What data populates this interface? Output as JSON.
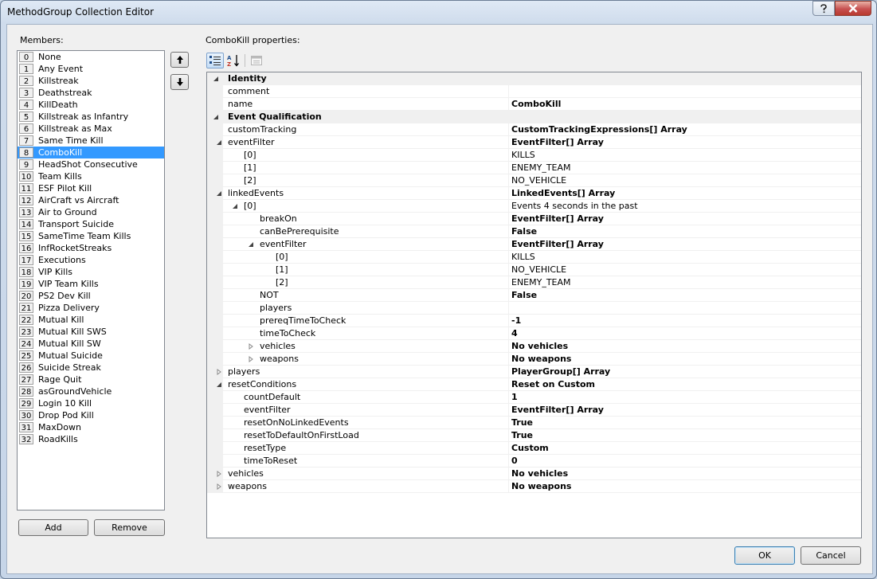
{
  "window": {
    "title": "MethodGroup Collection Editor"
  },
  "members_label": "Members:",
  "properties_label": "ComboKill properties:",
  "members": [
    {
      "index": "0",
      "name": "None"
    },
    {
      "index": "1",
      "name": "Any Event"
    },
    {
      "index": "2",
      "name": "Killstreak"
    },
    {
      "index": "3",
      "name": "Deathstreak"
    },
    {
      "index": "4",
      "name": "KillDeath"
    },
    {
      "index": "5",
      "name": "Killstreak as Infantry"
    },
    {
      "index": "6",
      "name": "Killstreak as Max"
    },
    {
      "index": "7",
      "name": "Same Time Kill"
    },
    {
      "index": "8",
      "name": "ComboKill"
    },
    {
      "index": "9",
      "name": "HeadShot Consecutive"
    },
    {
      "index": "10",
      "name": "Team Kills"
    },
    {
      "index": "11",
      "name": "ESF Pilot Kill"
    },
    {
      "index": "12",
      "name": "AirCraft vs Aircraft"
    },
    {
      "index": "13",
      "name": "Air to Ground"
    },
    {
      "index": "14",
      "name": "Transport Suicide"
    },
    {
      "index": "15",
      "name": "SameTime Team Kills"
    },
    {
      "index": "16",
      "name": "InfRocketStreaks"
    },
    {
      "index": "17",
      "name": "Executions"
    },
    {
      "index": "18",
      "name": "VIP Kills"
    },
    {
      "index": "19",
      "name": "VIP Team Kills"
    },
    {
      "index": "20",
      "name": "PS2 Dev Kill"
    },
    {
      "index": "21",
      "name": "Pizza Delivery"
    },
    {
      "index": "22",
      "name": "Mutual Kill"
    },
    {
      "index": "23",
      "name": "Mutual Kill SWS"
    },
    {
      "index": "24",
      "name": "Mutual Kill SW"
    },
    {
      "index": "25",
      "name": "Mutual Suicide"
    },
    {
      "index": "26",
      "name": "Suicide Streak"
    },
    {
      "index": "27",
      "name": "Rage Quit"
    },
    {
      "index": "28",
      "name": "asGroundVehicle"
    },
    {
      "index": "29",
      "name": "Login 10 Kill"
    },
    {
      "index": "30",
      "name": "Drop Pod Kill"
    },
    {
      "index": "31",
      "name": "MaxDown"
    },
    {
      "index": "32",
      "name": "RoadKills"
    }
  ],
  "selected_member_index": 8,
  "buttons": {
    "add": "Add",
    "remove": "Remove",
    "ok": "OK",
    "cancel": "Cancel"
  },
  "properties": [
    {
      "name": "Identity",
      "value": "",
      "category": true,
      "indent": 0,
      "expander": "expanded"
    },
    {
      "name": "comment",
      "value": "",
      "indent": 1
    },
    {
      "name": "name",
      "value": "ComboKill",
      "bold": true,
      "indent": 1
    },
    {
      "name": "Event Qualification",
      "value": "",
      "category": true,
      "indent": 0,
      "expander": "expanded"
    },
    {
      "name": "customTracking",
      "value": "CustomTrackingExpressions[] Array",
      "bold": true,
      "indent": 1
    },
    {
      "name": "eventFilter",
      "value": "EventFilter[] Array",
      "bold": true,
      "indent": 1,
      "expander": "expanded"
    },
    {
      "name": "[0]",
      "value": "KILLS",
      "indent": 2
    },
    {
      "name": "[1]",
      "value": "ENEMY_TEAM",
      "indent": 2
    },
    {
      "name": "[2]",
      "value": "NO_VEHICLE",
      "indent": 2
    },
    {
      "name": "linkedEvents",
      "value": "LinkedEvents[] Array",
      "bold": true,
      "indent": 1,
      "expander": "expanded"
    },
    {
      "name": "[0]",
      "value": "Events 4 seconds in the past",
      "indent": 2,
      "expander": "expanded"
    },
    {
      "name": "breakOn",
      "value": "EventFilter[] Array",
      "bold": true,
      "indent": 3
    },
    {
      "name": "canBePrerequisite",
      "value": "False",
      "bold": true,
      "indent": 3
    },
    {
      "name": "eventFilter",
      "value": "EventFilter[] Array",
      "bold": true,
      "indent": 3,
      "expander": "expanded"
    },
    {
      "name": "[0]",
      "value": "KILLS",
      "indent": 4
    },
    {
      "name": "[1]",
      "value": "NO_VEHICLE",
      "indent": 4
    },
    {
      "name": "[2]",
      "value": "ENEMY_TEAM",
      "indent": 4
    },
    {
      "name": "NOT",
      "value": "False",
      "bold": true,
      "indent": 3
    },
    {
      "name": "players",
      "value": "",
      "indent": 3
    },
    {
      "name": "prereqTimeToCheck",
      "value": "-1",
      "bold": true,
      "indent": 3
    },
    {
      "name": "timeToCheck",
      "value": "4",
      "bold": true,
      "indent": 3
    },
    {
      "name": "vehicles",
      "value": "No vehicles",
      "bold": true,
      "indent": 3,
      "expander": "collapsed"
    },
    {
      "name": "weapons",
      "value": "No weapons",
      "bold": true,
      "indent": 3,
      "expander": "collapsed"
    },
    {
      "name": "players",
      "value": "PlayerGroup[] Array",
      "bold": true,
      "indent": 1,
      "expander": "collapsed"
    },
    {
      "name": "resetConditions",
      "value": "Reset on Custom",
      "bold": true,
      "indent": 1,
      "expander": "expanded"
    },
    {
      "name": "countDefault",
      "value": "1",
      "bold": true,
      "indent": 2
    },
    {
      "name": "eventFilter",
      "value": "EventFilter[] Array",
      "bold": true,
      "indent": 2
    },
    {
      "name": "resetOnNoLinkedEvents",
      "value": "True",
      "bold": true,
      "indent": 2
    },
    {
      "name": "resetToDefaultOnFirstLoad",
      "value": "True",
      "bold": true,
      "indent": 2
    },
    {
      "name": "resetType",
      "value": "Custom",
      "bold": true,
      "indent": 2
    },
    {
      "name": "timeToReset",
      "value": "0",
      "bold": true,
      "indent": 2
    },
    {
      "name": "vehicles",
      "value": "No vehicles",
      "bold": true,
      "indent": 1,
      "expander": "collapsed"
    },
    {
      "name": "weapons",
      "value": "No weapons",
      "bold": true,
      "indent": 1,
      "expander": "collapsed"
    }
  ],
  "icons": {
    "help": "question-mark-icon",
    "close": "close-icon",
    "move_up": "arrow-up-icon",
    "move_down": "arrow-down-icon",
    "categorized": "categorized-icon",
    "alphabetical": "sort-alphabetical-icon",
    "property_pages": "property-pages-icon"
  },
  "colors": {
    "selection": "#3399ff",
    "window_frame": "#c9d7e8",
    "category_band": "#f0f0f0"
  }
}
